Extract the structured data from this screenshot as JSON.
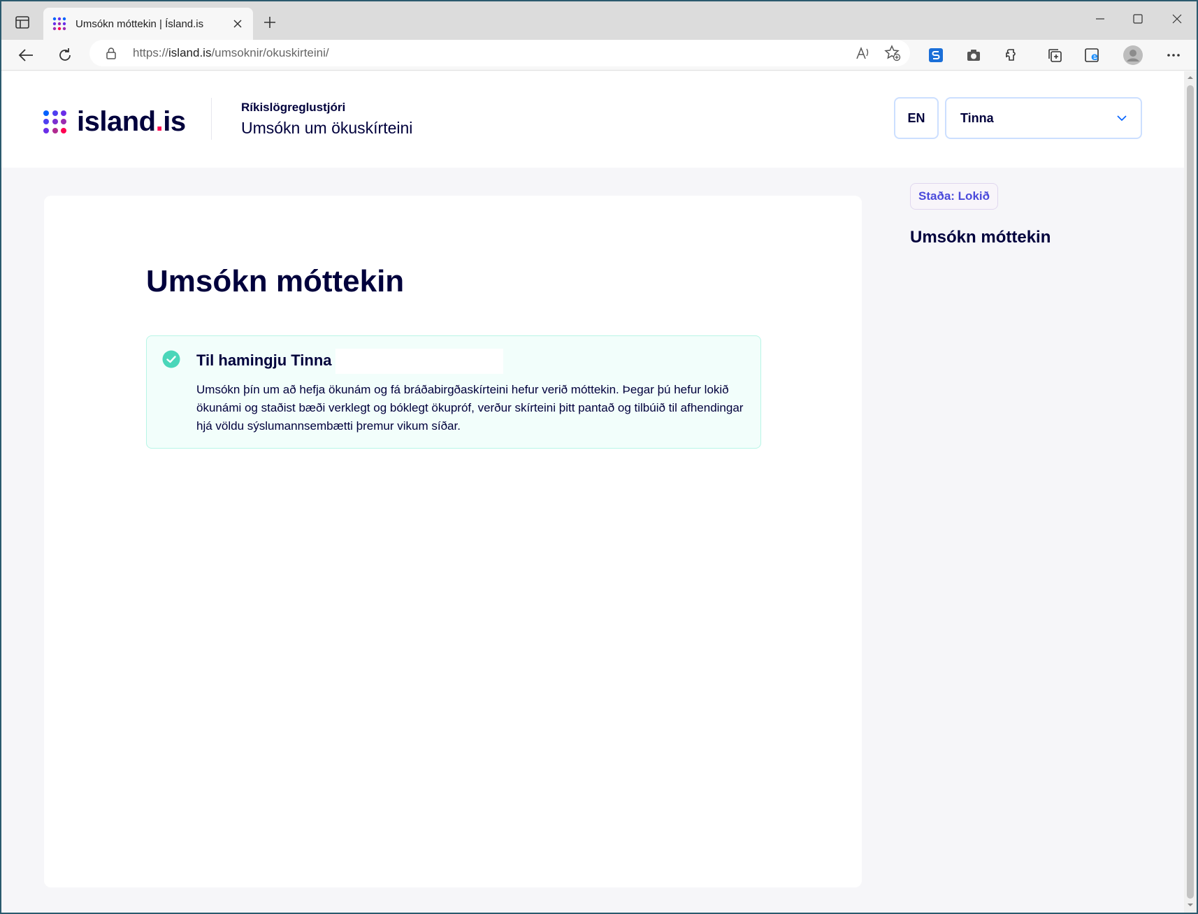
{
  "browser": {
    "tab_title": "Umsókn móttekin | Ísland.is",
    "url_prefix": "https://",
    "url_host": "island.is",
    "url_path": "/umsoknir/okuskirteini/"
  },
  "header": {
    "logo_main": "island",
    "logo_dot": ".",
    "logo_suffix": "is",
    "org_name": "Ríkislögreglustjóri",
    "org_subtitle": "Umsókn um ökuskírteini",
    "lang_button": "EN",
    "user_name": "Tinna"
  },
  "main": {
    "title": "Umsókn móttekin",
    "alert": {
      "title": "Til hamingju Tinna",
      "body": "Umsókn þín um að hefja ökunám og fá bráðabirgðaskírteini hefur verið móttekin. Þegar þú hefur lokið ökunámi og staðist bæði verklegt og bóklegt ökupróf, verður skírteini þitt pantað og tilbúið til afhendingar hjá völdu sýslumannsembætti þremur vikum síðar."
    }
  },
  "sidebar": {
    "status": "Staða: Lokið",
    "title": "Umsókn móttekin"
  },
  "colors": {
    "brand_dark": "#00003c",
    "brand_accent": "#ff0050",
    "success": "#4ad6b9",
    "status_text": "#4a4adb"
  }
}
